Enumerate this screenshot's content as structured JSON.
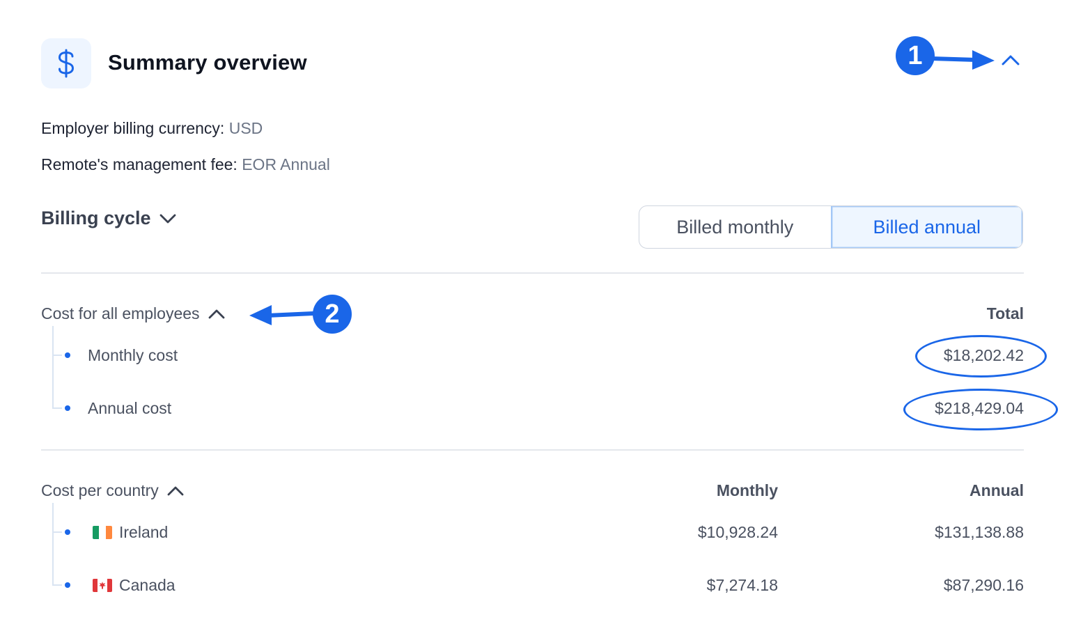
{
  "header": {
    "icon": "dollar-icon",
    "title": "Summary overview"
  },
  "info": {
    "currency_label": "Employer billing currency:",
    "currency_value": "USD",
    "fee_label": "Remote's management fee:",
    "fee_value": "EOR Annual"
  },
  "billing": {
    "label": "Billing cycle",
    "options": [
      "Billed monthly",
      "Billed annual"
    ],
    "selected": "Billed annual"
  },
  "employees": {
    "label": "Cost for all employees",
    "total_header": "Total",
    "rows": [
      {
        "label": "Monthly cost",
        "total": "$18,202.42"
      },
      {
        "label": "Annual cost",
        "total": "$218,429.04"
      }
    ]
  },
  "countries": {
    "label": "Cost per country",
    "monthly_header": "Monthly",
    "annual_header": "Annual",
    "rows": [
      {
        "name": "Ireland",
        "flag": "ireland-flag-icon",
        "monthly": "$10,928.24",
        "annual": "$131,138.88"
      },
      {
        "name": "Canada",
        "flag": "canada-flag-icon",
        "monthly": "$7,274.18",
        "annual": "$87,290.16"
      }
    ]
  },
  "annotations": {
    "badge1": "1",
    "badge2": "2"
  },
  "colors": {
    "accent": "#1a66e8",
    "icon_bg": "#eef5ff"
  }
}
